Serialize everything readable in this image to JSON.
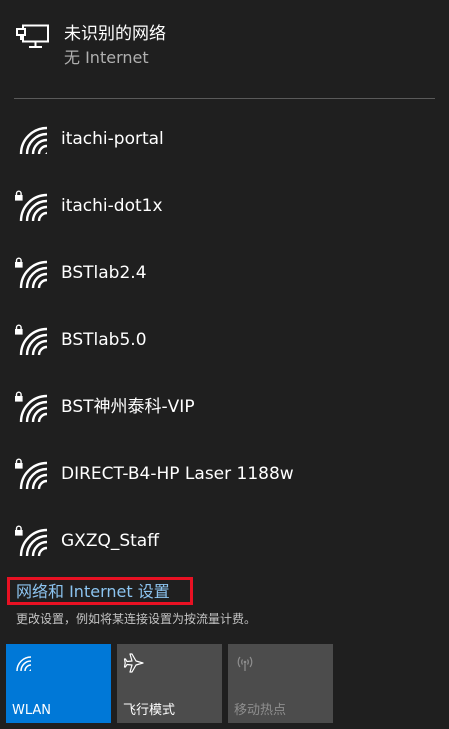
{
  "current_network": {
    "name": "未识别的网络",
    "status": "无 Internet"
  },
  "networks": [
    {
      "name": "itachi-portal",
      "secured": false
    },
    {
      "name": "itachi-dot1x",
      "secured": true
    },
    {
      "name": "BSTlab2.4",
      "secured": true
    },
    {
      "name": "BSTlab5.0",
      "secured": true
    },
    {
      "name": "BST神州泰科-VIP",
      "secured": true
    },
    {
      "name": "DIRECT-B4-HP Laser 1188w",
      "secured": true
    },
    {
      "name": "GXZQ_Staff",
      "secured": true
    }
  ],
  "settings": {
    "link_label": "网络和 Internet 设置",
    "description": "更改设置，例如将某连接设置为按流量计费。"
  },
  "quick_actions": [
    {
      "label": "WLAN",
      "icon": "wifi-icon",
      "state": "on"
    },
    {
      "label": "飞行模式",
      "icon": "airplane-icon",
      "state": "off"
    },
    {
      "label": "移动热点",
      "icon": "hotspot-icon",
      "state": "disabled"
    }
  ],
  "colors": {
    "background": "#1f1f1f",
    "accent": "#0078d7",
    "link": "#8cc4f0",
    "highlight_border": "#e81123",
    "tile_off": "#4c4c4c"
  }
}
